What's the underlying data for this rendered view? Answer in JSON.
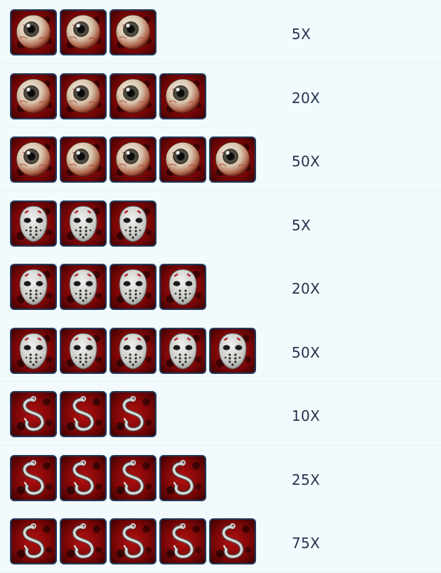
{
  "paytable": {
    "rows": [
      {
        "symbol": "eyeball-icon",
        "count": 3,
        "multiplier": "5X"
      },
      {
        "symbol": "eyeball-icon",
        "count": 4,
        "multiplier": "20X"
      },
      {
        "symbol": "eyeball-icon",
        "count": 5,
        "multiplier": "50X"
      },
      {
        "symbol": "hockey-mask-icon",
        "count": 3,
        "multiplier": "5X"
      },
      {
        "symbol": "hockey-mask-icon",
        "count": 4,
        "multiplier": "20X"
      },
      {
        "symbol": "hockey-mask-icon",
        "count": 5,
        "multiplier": "50X"
      },
      {
        "symbol": "meat-hook-icon",
        "count": 3,
        "multiplier": "10X"
      },
      {
        "symbol": "meat-hook-icon",
        "count": 4,
        "multiplier": "25X"
      },
      {
        "symbol": "meat-hook-icon",
        "count": 5,
        "multiplier": "75X"
      }
    ]
  },
  "colors": {
    "background": "#f3fafd",
    "text": "#22344f",
    "tile_red": "#8a0808",
    "tile_border": "#1f3b5e"
  }
}
